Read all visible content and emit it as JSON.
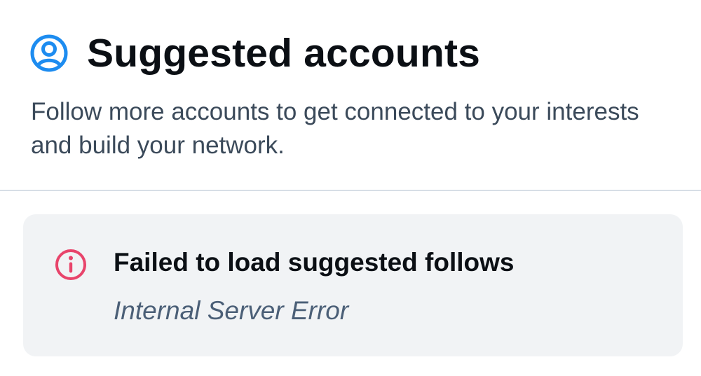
{
  "header": {
    "icon": "user-circle-icon",
    "title": "Suggested accounts",
    "accent_color": "#1d8cf0"
  },
  "description": "Follow more accounts to get connected to your interests and build your network.",
  "error": {
    "icon": "info-circle-icon",
    "icon_color": "#e8446b",
    "title": "Failed to load suggested follows",
    "detail": "Internal Server Error"
  }
}
